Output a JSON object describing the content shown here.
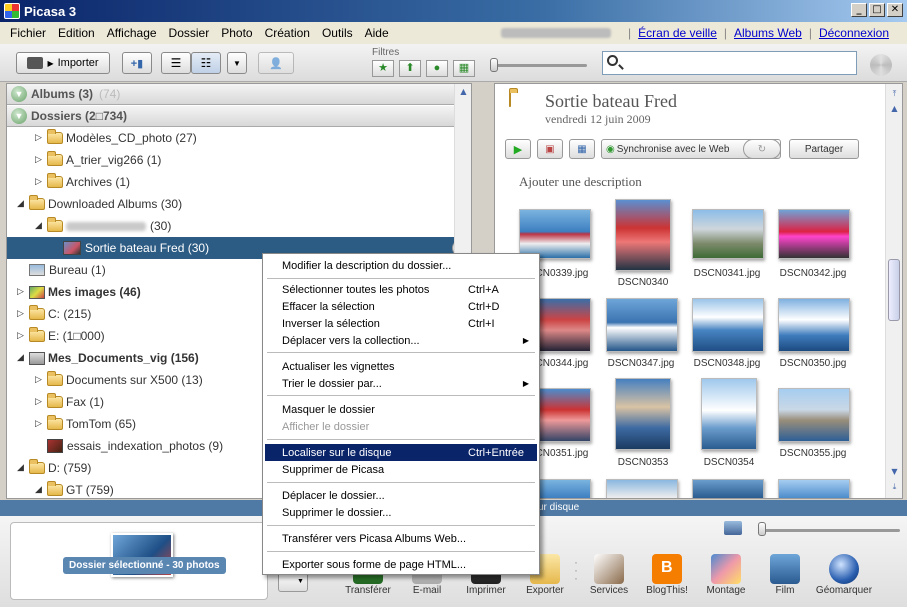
{
  "window": {
    "title": "Picasa 3"
  },
  "menubar": {
    "items": [
      "Fichier",
      "Edition",
      "Affichage",
      "Dossier",
      "Photo",
      "Création",
      "Outils",
      "Aide"
    ],
    "links": [
      "Écran de veille",
      "Albums Web",
      "Déconnexion"
    ]
  },
  "toolbar": {
    "import_label": "Importer",
    "filters_label": "Filtres"
  },
  "tree": {
    "albums": {
      "label": "Albums (3)",
      "count": "(74)"
    },
    "dossiers": {
      "label": "Dossiers (2□734)"
    },
    "rows": [
      {
        "label": "Modèles_CD_photo (27)"
      },
      {
        "label": "A_trier_vig266 (1)"
      },
      {
        "label": "Archives (1)"
      },
      {
        "label": "Downloaded Albums (30)"
      },
      {
        "label": "(30)"
      },
      {
        "label": "Sortie bateau Fred (30)"
      },
      {
        "label": "Bureau (1)"
      },
      {
        "label": "Mes images (46)"
      },
      {
        "label": "C: (215)"
      },
      {
        "label": "E: (1□000)"
      },
      {
        "label": "Mes_Documents_vig (156)"
      },
      {
        "label": "Documents sur X500 (13)"
      },
      {
        "label": "Fax (1)"
      },
      {
        "label": "TomTom (65)"
      },
      {
        "label": "essais_indexation_photos (9)"
      },
      {
        "label": "D: (759)"
      },
      {
        "label": "GT (759)"
      }
    ]
  },
  "album": {
    "title": "Sortie bateau Fred",
    "date": "vendredi 12 juin 2009",
    "description": "Ajouter une description",
    "actions": {
      "sync": "Synchronise avec le Web",
      "share": "Partager"
    },
    "photos": [
      {
        "name": "DSCN0339.jpg"
      },
      {
        "name": "DSCN0340"
      },
      {
        "name": "DSCN0341.jpg"
      },
      {
        "name": "DSCN0342.jpg"
      },
      {
        "name": "DSCN0344.jpg"
      },
      {
        "name": "DSCN0347.jpg"
      },
      {
        "name": "DSCN0348.jpg"
      },
      {
        "name": "DSCN0350.jpg"
      },
      {
        "name": "DSCN0351.jpg"
      },
      {
        "name": "DSCN0353"
      },
      {
        "name": "DSCN0354"
      },
      {
        "name": "DSCN0355.jpg"
      }
    ]
  },
  "statusbar": {
    "text": "ur disque"
  },
  "tray": {
    "badge": "Dossier sélectionné - 30 photos",
    "actions": [
      "Transférer",
      "E-mail",
      "Imprimer",
      "Exporter",
      "Services",
      "BlogThis!",
      "Montage",
      "Film",
      "Géomarquer"
    ]
  },
  "context_menu": {
    "items": [
      {
        "label": "Modifier la description du dossier...",
        "shortcut": ""
      },
      {
        "label": "Sélectionner toutes les photos",
        "shortcut": "Ctrl+A"
      },
      {
        "label": "Effacer la sélection",
        "shortcut": "Ctrl+D"
      },
      {
        "label": "Inverser la sélection",
        "shortcut": "Ctrl+I"
      },
      {
        "label": "Déplacer vers la collection...",
        "shortcut": ""
      },
      {
        "label": "Actualiser les vignettes",
        "shortcut": ""
      },
      {
        "label": "Trier le dossier par...",
        "shortcut": ""
      },
      {
        "label": "Masquer le dossier",
        "shortcut": ""
      },
      {
        "label": "Afficher le dossier",
        "shortcut": ""
      },
      {
        "label": "Localiser sur le disque",
        "shortcut": "Ctrl+Entrée"
      },
      {
        "label": "Supprimer de Picasa",
        "shortcut": ""
      },
      {
        "label": "Déplacer le dossier...",
        "shortcut": ""
      },
      {
        "label": "Supprimer le dossier...",
        "shortcut": ""
      },
      {
        "label": "Transférer vers Picasa Albums Web...",
        "shortcut": ""
      },
      {
        "label": "Exporter sous forme de page HTML...",
        "shortcut": ""
      }
    ]
  }
}
